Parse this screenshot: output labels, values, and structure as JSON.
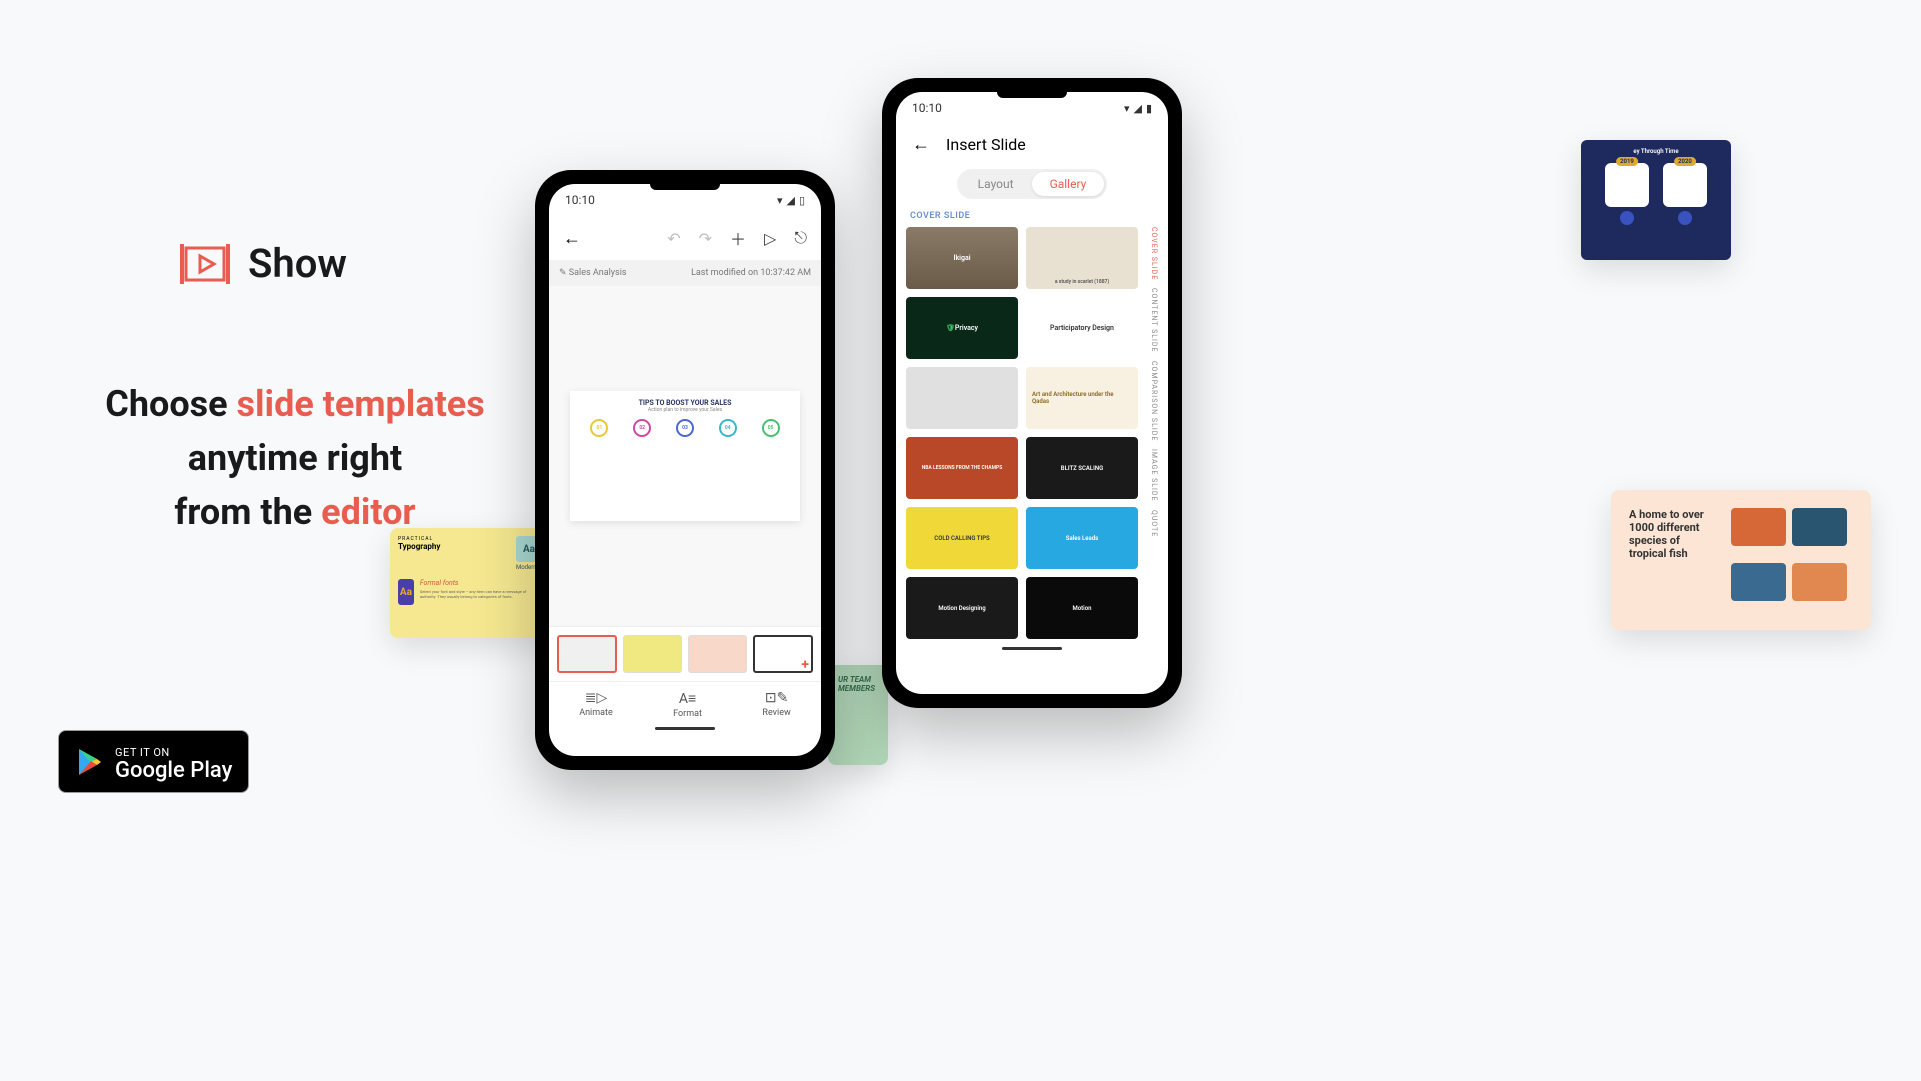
{
  "app": {
    "name": "Show"
  },
  "headline": {
    "part1": "Choose ",
    "accent1": "slide templates",
    "part2": "anytime right",
    "part3": "from the ",
    "accent2": "editor"
  },
  "play_badge": {
    "top": "GET IT ON",
    "bottom": "Google Play"
  },
  "phone1": {
    "time": "10:10",
    "doc_name": "Sales Analysis",
    "modified": "Last modified on 10:37:42 AM",
    "slide_title": "TIPS TO BOOST YOUR SALES",
    "slide_sub": "Action plan to improve your Sales",
    "nodes": [
      "01",
      "02",
      "03",
      "04",
      "05"
    ],
    "bottom_tabs": {
      "animate": "Animate",
      "format": "Format",
      "review": "Review"
    }
  },
  "phone2": {
    "time": "10:10",
    "title": "Insert Slide",
    "tabs": {
      "layout": "Layout",
      "gallery": "Gallery"
    },
    "section": "COVER SLIDE",
    "side_categories": [
      "COVER SLIDE",
      "CONTENT SLIDE",
      "COMPARISON SLIDE",
      "IMAGE SLIDE",
      "QUOTE"
    ],
    "templates": {
      "ikigai": "Ikigai",
      "privacy": "Privacy",
      "participatory": "Participatory Design",
      "study": "a study in scarlet (1887)",
      "art": "Art and Architecture under the Qadas",
      "nba": "NBA LESSONS FROM THE CHAMPS",
      "blitz": "BLITZ SCALING",
      "cold": "COLD CALLING TIPS",
      "leads": "Sales Leads",
      "motion1": "Motion Designing",
      "motion2": "Motion"
    }
  },
  "deco": {
    "typography": {
      "label1": "PRACTICAL",
      "label2": "Typography",
      "modern": "Modern",
      "formal": "Formal fonts"
    },
    "team": "UR TEAM MEMBERS",
    "navy": {
      "title": "ey Through Time",
      "y1": "2019",
      "y2": "2020"
    },
    "peach": "A home to over 1000 different species of tropical fish"
  }
}
